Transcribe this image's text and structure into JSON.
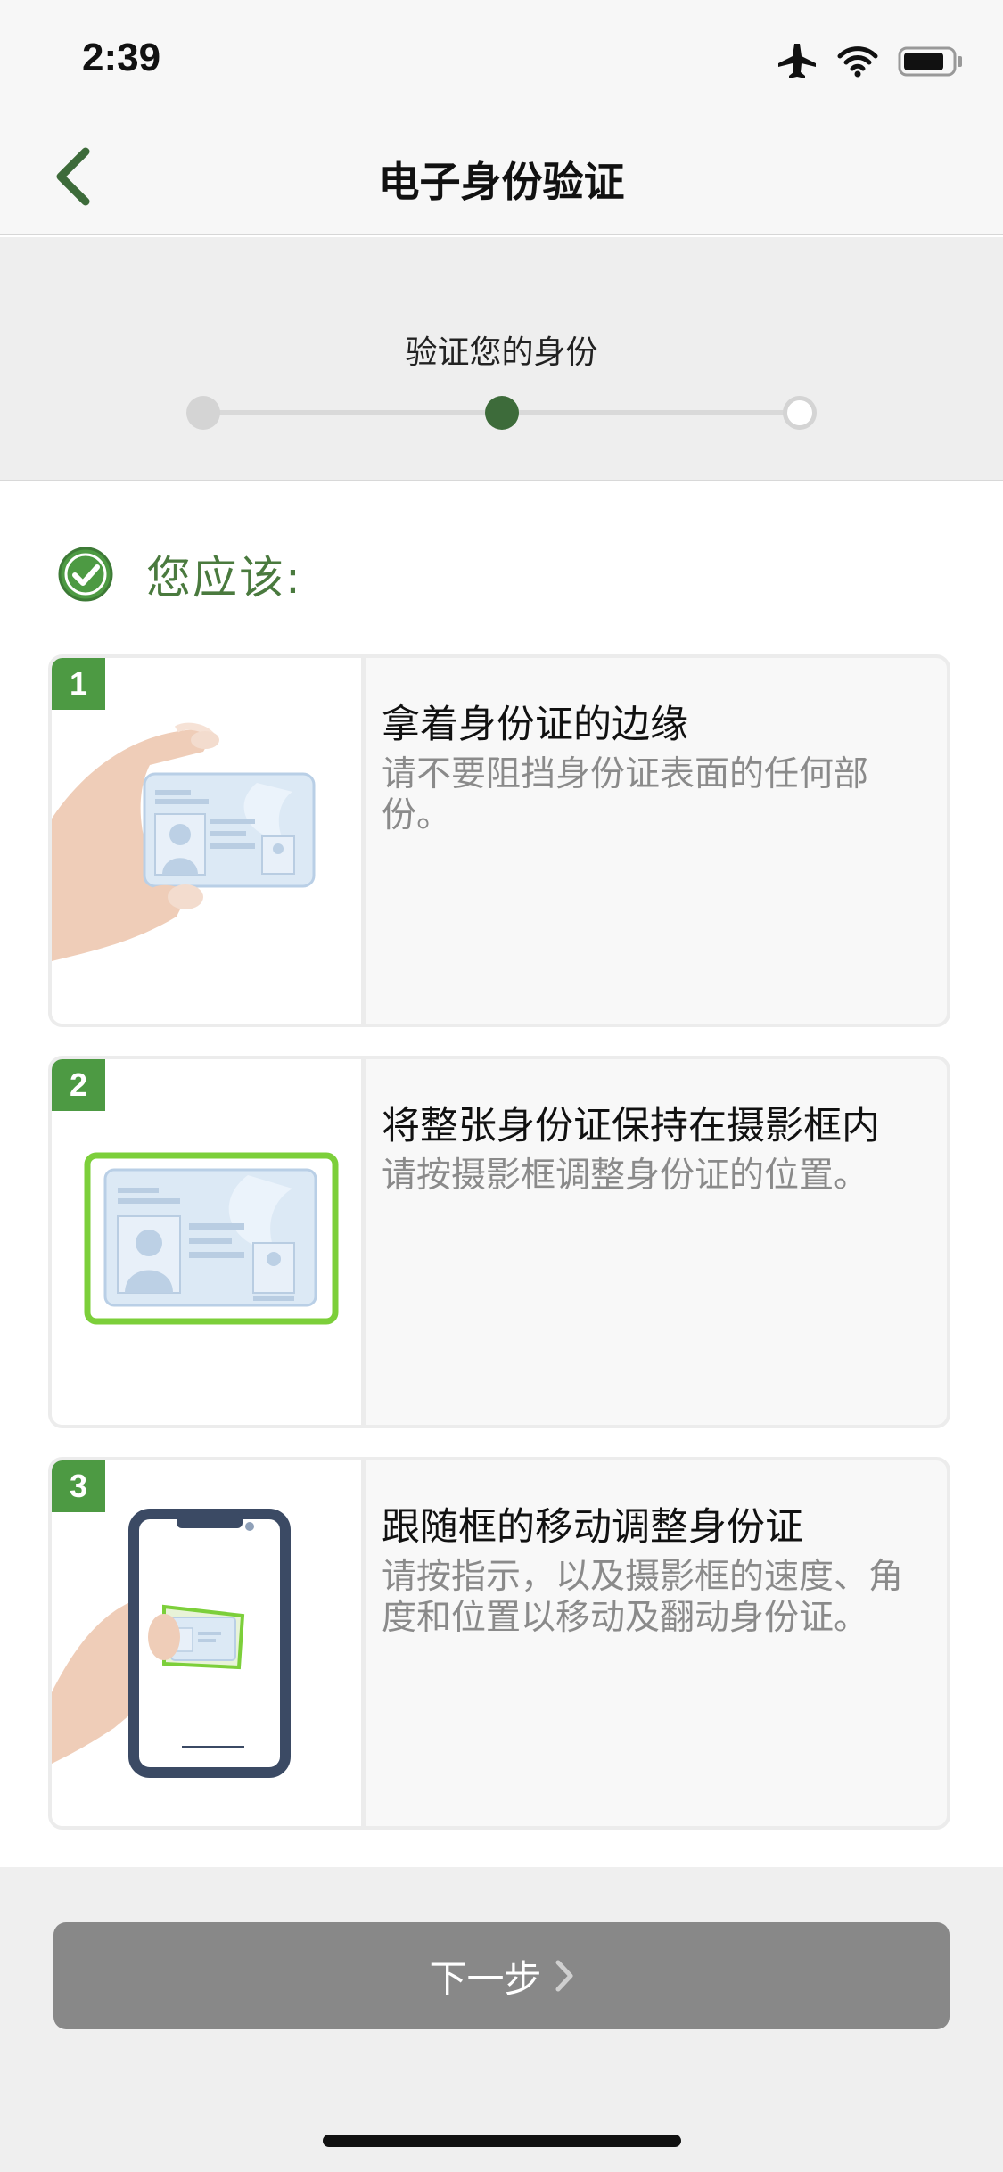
{
  "status_bar": {
    "time": "2:39",
    "icons": [
      "airplane-icon",
      "wifi-icon",
      "battery-icon"
    ]
  },
  "nav": {
    "title": "电子身份验证",
    "back_icon": "chevron-left-icon"
  },
  "progress": {
    "title": "验证您的身份",
    "total_steps": 3,
    "current_step": 2
  },
  "section": {
    "title": "您应该:"
  },
  "steps": [
    {
      "number": "1",
      "heading": "拿着身份证的边缘",
      "description": "请不要阻挡身份证表面的任何部份。"
    },
    {
      "number": "2",
      "heading": "将整张身份证保持在摄影框内",
      "description": "请按摄影框调整身份证的位置。"
    },
    {
      "number": "3",
      "heading": "跟随框的移动调整身份证",
      "description": "请按指示，以及摄影框的速度、角度和位置以移动及翻动身份证。"
    }
  ],
  "footer": {
    "next_label": "下一步"
  },
  "colors": {
    "accent_green": "#3d6b3a",
    "badge_green": "#4d9a43",
    "frame_green": "#7ccf3a",
    "button_gray": "#888888"
  }
}
